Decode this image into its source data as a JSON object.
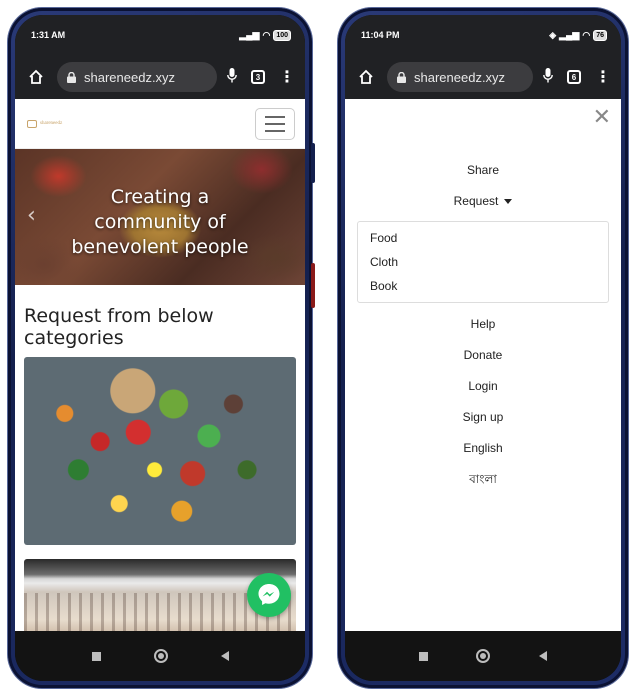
{
  "left_phone": {
    "status": {
      "time": "1:31 AM",
      "battery": "100"
    },
    "browser": {
      "url": "shareneedz.xyz",
      "tab_count": "3"
    },
    "page": {
      "hero_caption": "Creating a community of benevolent people",
      "section_title": "Request from below categories",
      "categories": [
        {
          "name": "food",
          "image": "fresh vegetables and fruits"
        },
        {
          "name": "cloth",
          "image": "clothes hanging on rack"
        }
      ]
    }
  },
  "right_phone": {
    "status": {
      "time": "11:04 PM",
      "battery": "76"
    },
    "browser": {
      "url": "shareneedz.xyz",
      "tab_count": "6"
    },
    "menu": {
      "share": "Share",
      "request": "Request",
      "request_options": [
        "Food",
        "Cloth",
        "Book"
      ],
      "help": "Help",
      "donate": "Donate",
      "login": "Login",
      "signup": "Sign up",
      "english": "English",
      "bangla": "বাংলা"
    }
  },
  "colors": {
    "browser_bar": "#202124",
    "url_pill": "#3c3c3f",
    "messenger_green": "#21c063",
    "phone_frame": "#14204e"
  }
}
